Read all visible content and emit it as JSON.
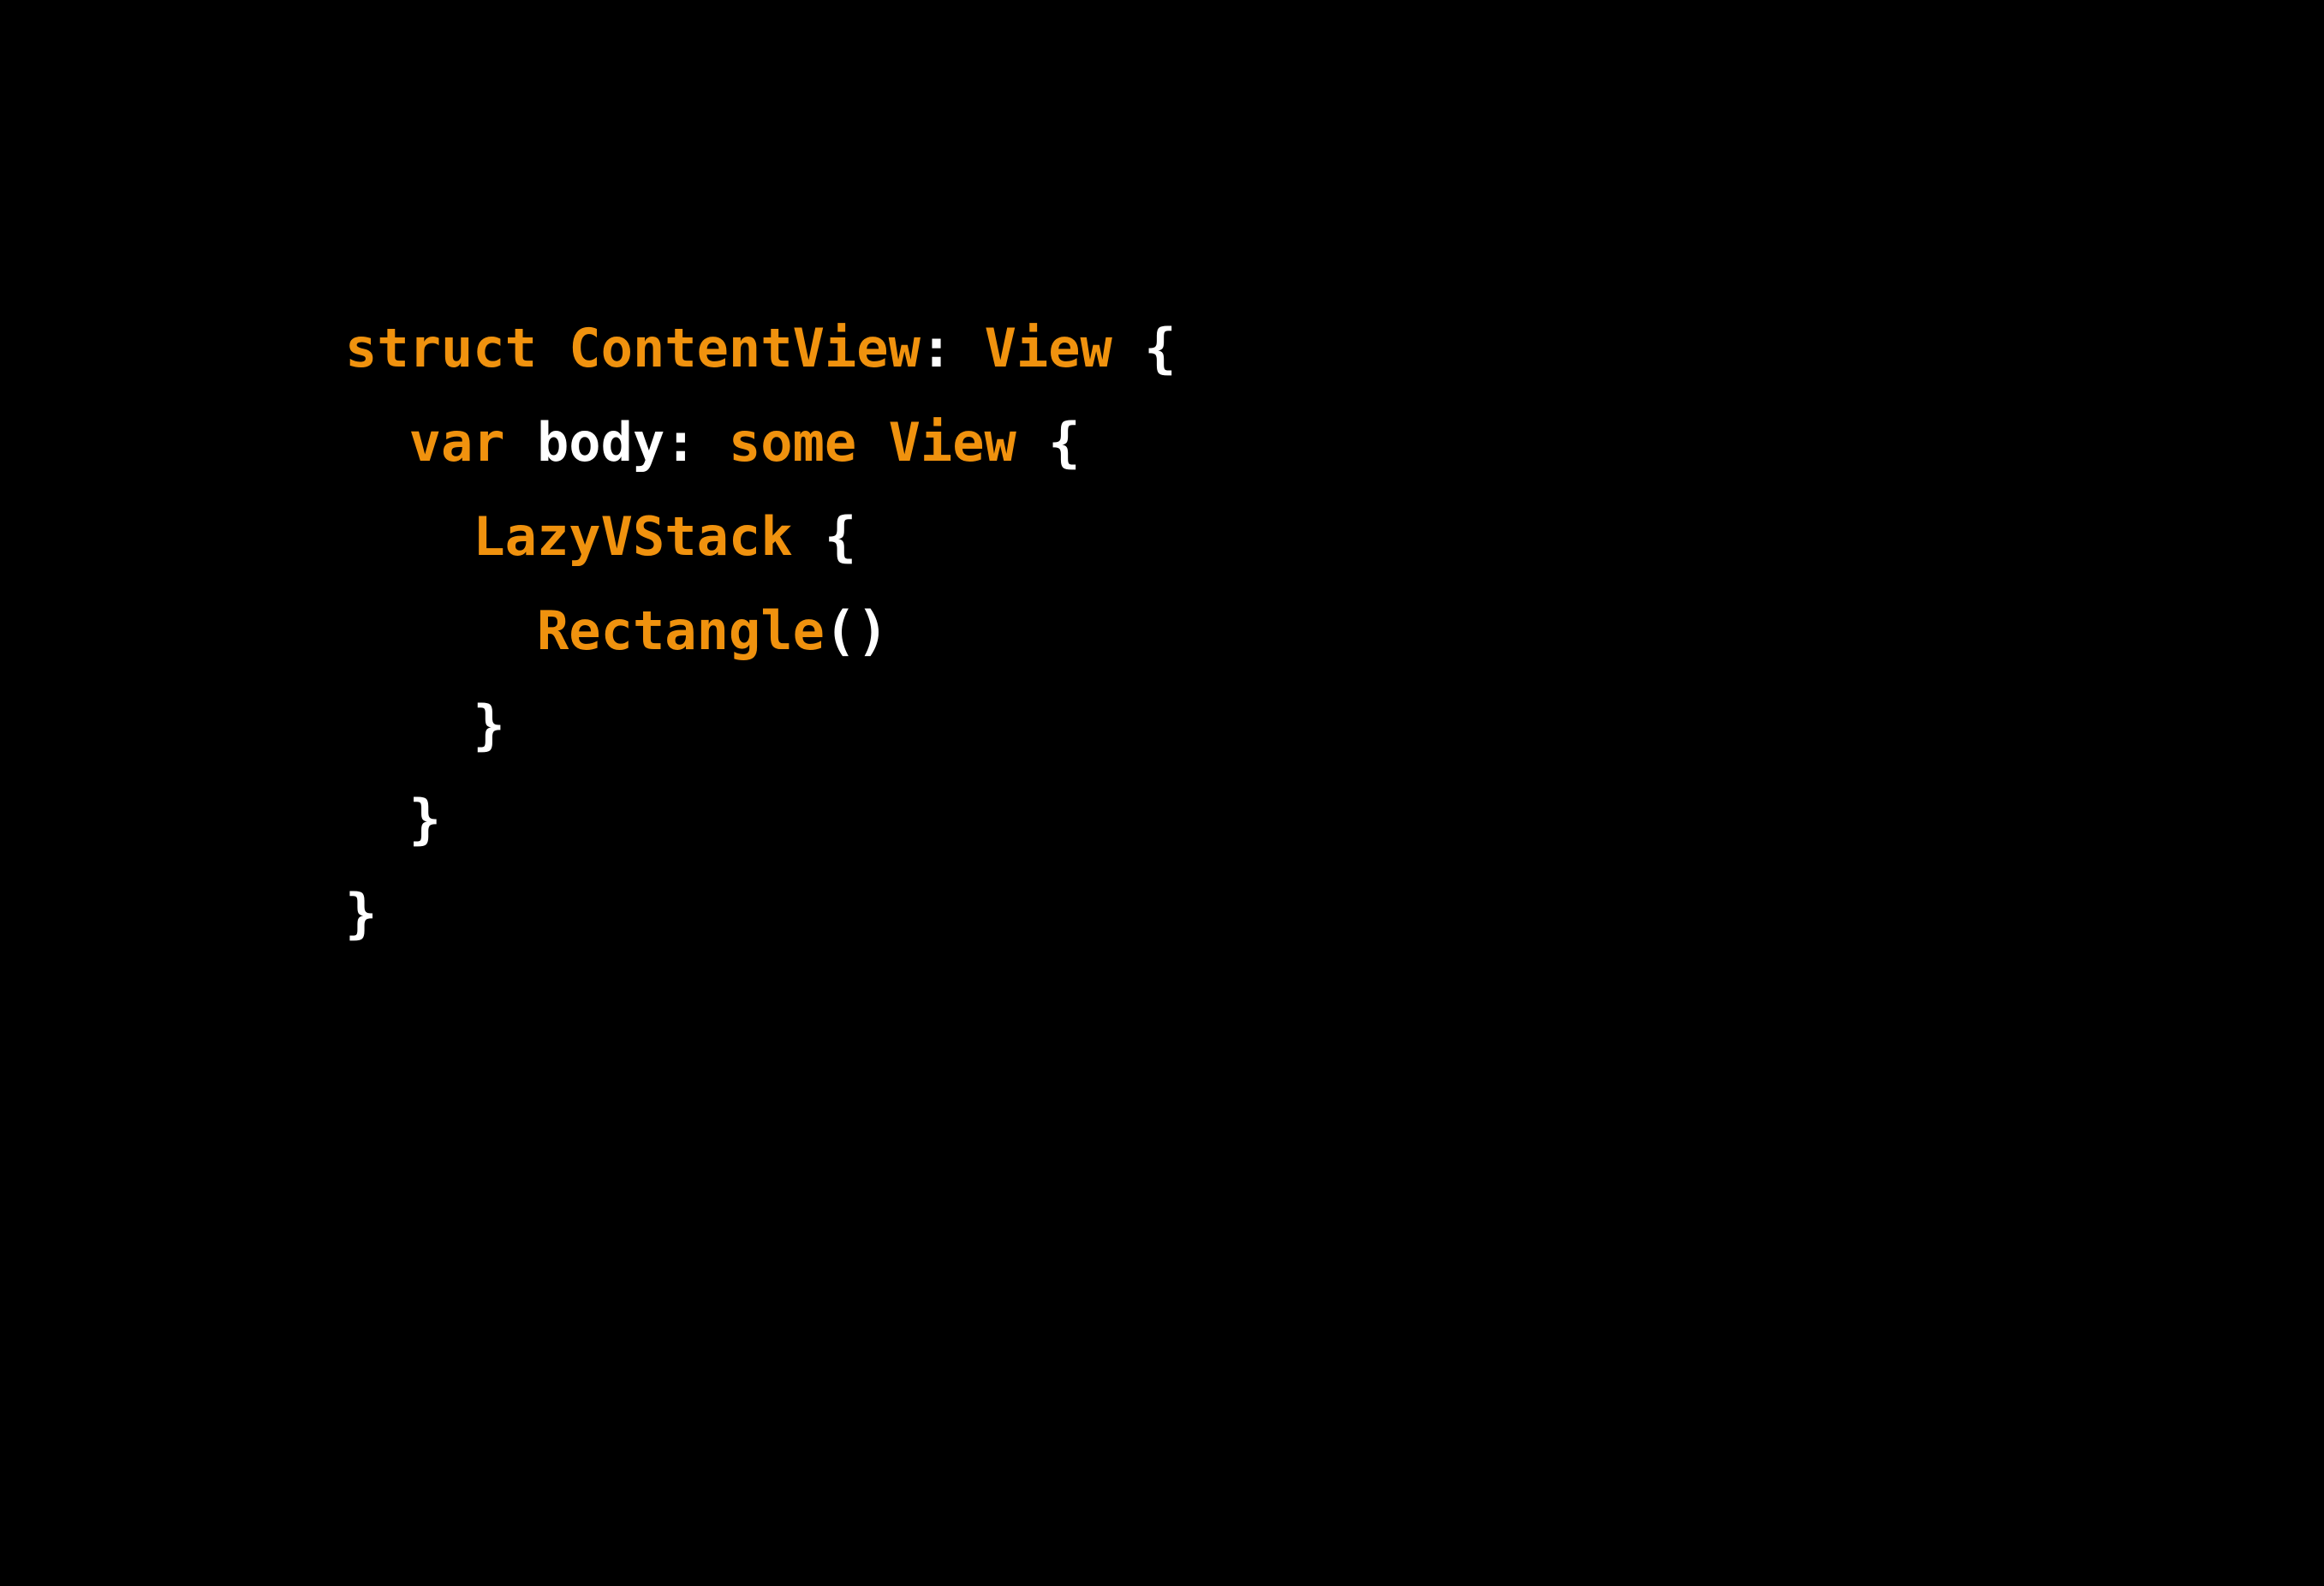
{
  "slide": {
    "background_color": "#000000",
    "language": "swift",
    "theme": {
      "keyword_color": "#F0920E",
      "type_color": "#F0920E",
      "identifier_color": "#FFFFFF",
      "punctuation_color": "#FFFFFF"
    }
  },
  "code": {
    "lines": [
      {
        "indent": 0,
        "tokens": [
          {
            "text": "struct",
            "kind": "keyword"
          },
          {
            "text": " ",
            "kind": "plain"
          },
          {
            "text": "ContentView",
            "kind": "type"
          },
          {
            "text": ":",
            "kind": "punctuation"
          },
          {
            "text": " ",
            "kind": "plain"
          },
          {
            "text": "View",
            "kind": "type"
          },
          {
            "text": " ",
            "kind": "plain"
          },
          {
            "text": "{",
            "kind": "punctuation"
          }
        ]
      },
      {
        "indent": 2,
        "tokens": [
          {
            "text": "var",
            "kind": "keyword"
          },
          {
            "text": " ",
            "kind": "plain"
          },
          {
            "text": "body",
            "kind": "identifier"
          },
          {
            "text": ":",
            "kind": "punctuation"
          },
          {
            "text": " ",
            "kind": "plain"
          },
          {
            "text": "some",
            "kind": "keyword"
          },
          {
            "text": " ",
            "kind": "plain"
          },
          {
            "text": "View",
            "kind": "type"
          },
          {
            "text": " ",
            "kind": "plain"
          },
          {
            "text": "{",
            "kind": "punctuation"
          }
        ]
      },
      {
        "indent": 4,
        "tokens": [
          {
            "text": "LazyVStack",
            "kind": "type"
          },
          {
            "text": " ",
            "kind": "plain"
          },
          {
            "text": "{",
            "kind": "punctuation"
          }
        ]
      },
      {
        "indent": 6,
        "tokens": [
          {
            "text": "Rectangle",
            "kind": "type"
          },
          {
            "text": "()",
            "kind": "punctuation"
          }
        ]
      },
      {
        "indent": 4,
        "tokens": [
          {
            "text": "}",
            "kind": "punctuation"
          }
        ]
      },
      {
        "indent": 2,
        "tokens": [
          {
            "text": "}",
            "kind": "punctuation"
          }
        ]
      },
      {
        "indent": 0,
        "tokens": [
          {
            "text": "}",
            "kind": "punctuation"
          }
        ]
      }
    ],
    "plain_text": "struct ContentView: View {\n  var body: some View {\n    LazyVStack {\n      Rectangle()\n    }\n  }\n}"
  }
}
